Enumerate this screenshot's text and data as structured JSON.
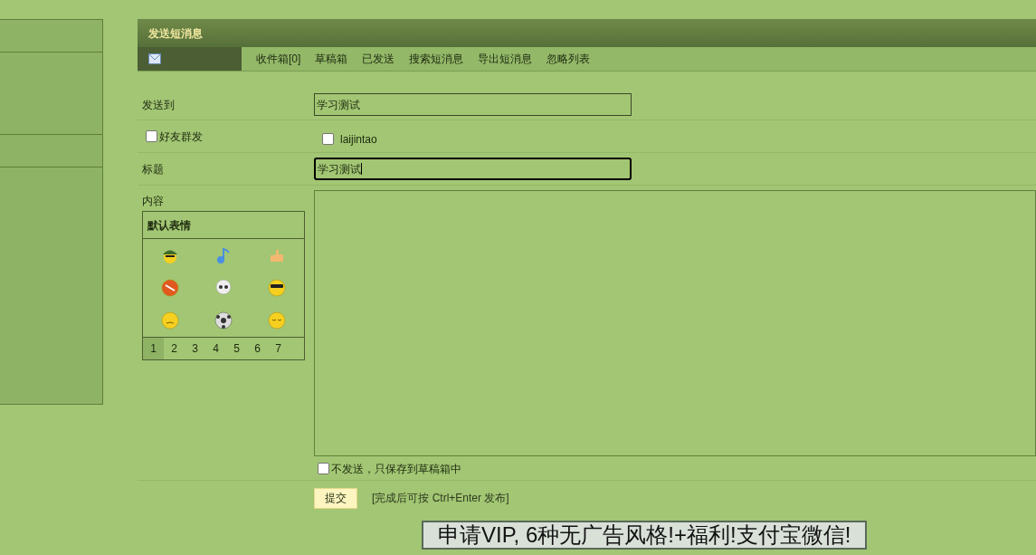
{
  "header": {
    "title": "发送短消息"
  },
  "tabs": [
    {
      "label": "收件箱[0]",
      "selected": false
    },
    {
      "label": "草稿箱",
      "selected": false
    },
    {
      "label": "已发送",
      "selected": false
    },
    {
      "label": "搜索短消息",
      "selected": false
    },
    {
      "label": "导出短消息",
      "selected": false
    },
    {
      "label": "忽略列表",
      "selected": false
    }
  ],
  "form": {
    "send_to": {
      "label": "发送到",
      "value": "学习测试"
    },
    "group_send": {
      "label": "好友群发",
      "checked": false
    },
    "friends": [
      {
        "name": "laijintao",
        "checked": false
      }
    ],
    "subject": {
      "label": "标题",
      "value": "学习测试",
      "focused": true
    },
    "content": {
      "label": "内容"
    },
    "save_draft": {
      "label": "不发送，只保存到草稿箱中",
      "checked": false
    },
    "submit": "提交",
    "hint": "[完成后可按 Ctrl+Enter 发布]"
  },
  "emoticons": {
    "title": "默认表情",
    "pages": [
      {
        "label": "1",
        "selected": true
      },
      {
        "label": "2",
        "selected": false
      },
      {
        "label": "3",
        "selected": false
      },
      {
        "label": "4",
        "selected": false
      },
      {
        "label": "5",
        "selected": false
      },
      {
        "label": "6",
        "selected": false
      },
      {
        "label": "7",
        "selected": false
      }
    ]
  },
  "banner": "申请VIP, 6种无广告风格!+福利!支付宝微信!"
}
